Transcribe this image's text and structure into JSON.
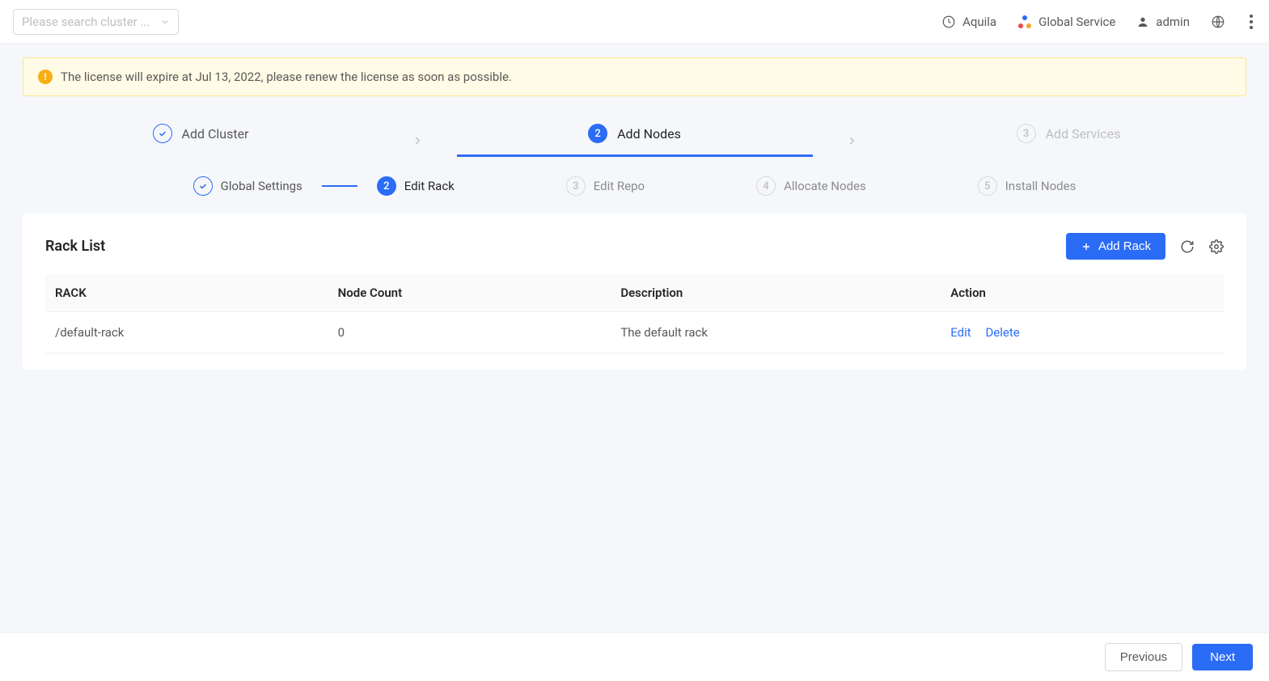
{
  "header": {
    "search_placeholder": "Please search cluster ...",
    "nav": {
      "aquila": "Aquila",
      "global_service": "Global Service",
      "admin": "admin"
    }
  },
  "alert": {
    "text": "The license will expire at Jul 13, 2022, please renew the license as soon as possible."
  },
  "major_steps": [
    {
      "label": "Add Cluster",
      "state": "done"
    },
    {
      "label": "Add Nodes",
      "state": "current",
      "index": "2"
    },
    {
      "label": "Add Services",
      "state": "pending",
      "index": "3"
    }
  ],
  "sub_steps": [
    {
      "label": "Global Settings",
      "state": "done"
    },
    {
      "label": "Edit Rack",
      "state": "current",
      "index": "2"
    },
    {
      "label": "Edit Repo",
      "state": "pending",
      "index": "3"
    },
    {
      "label": "Allocate Nodes",
      "state": "pending",
      "index": "4"
    },
    {
      "label": "Install Nodes",
      "state": "pending",
      "index": "5"
    }
  ],
  "card": {
    "title": "Rack List",
    "add_button": "Add Rack"
  },
  "table": {
    "columns": [
      "RACK",
      "Node Count",
      "Description",
      "Action"
    ],
    "rows": [
      {
        "rack": "/default-rack",
        "node_count": "0",
        "description": "The default rack"
      }
    ],
    "actions": {
      "edit": "Edit",
      "delete": "Delete"
    }
  },
  "footer": {
    "previous": "Previous",
    "next": "Next"
  }
}
